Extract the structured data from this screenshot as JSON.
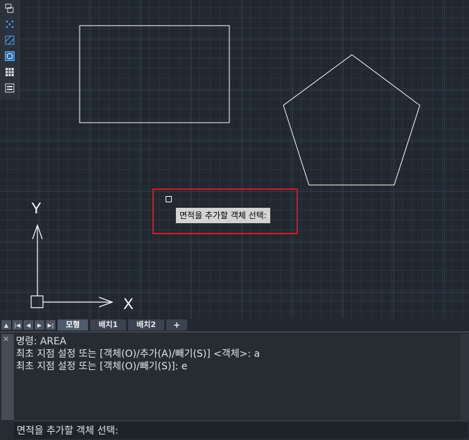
{
  "canvas": {
    "ucs_x_label": "X",
    "ucs_y_label": "Y"
  },
  "palette": {
    "icons": [
      "layer-properties-icon",
      "points-icon",
      "hatch-icon",
      "circle-select-icon",
      "table-icon",
      "properties-panel-icon"
    ]
  },
  "prompt": {
    "tooltip": "면적을 추가할 객체 선택:",
    "highlight_color": "#e0161b"
  },
  "tabs": {
    "nav": [
      "▲",
      "|◀",
      "◀",
      "▶",
      "▶|"
    ],
    "items": [
      {
        "label": "모형"
      },
      {
        "label": "배치1"
      },
      {
        "label": "배치2"
      },
      {
        "label": "+"
      }
    ]
  },
  "command": {
    "close": "✕",
    "history": [
      "명령: AREA",
      "최초 지점 설정 또는 [객체(O)/추가(A)/빼기(S)] <객체>: a",
      "최초 지점 설정 또는 [객체(O)/빼기(S)]: e"
    ],
    "current_prompt": "면적을 추가할 객체 선택:"
  }
}
